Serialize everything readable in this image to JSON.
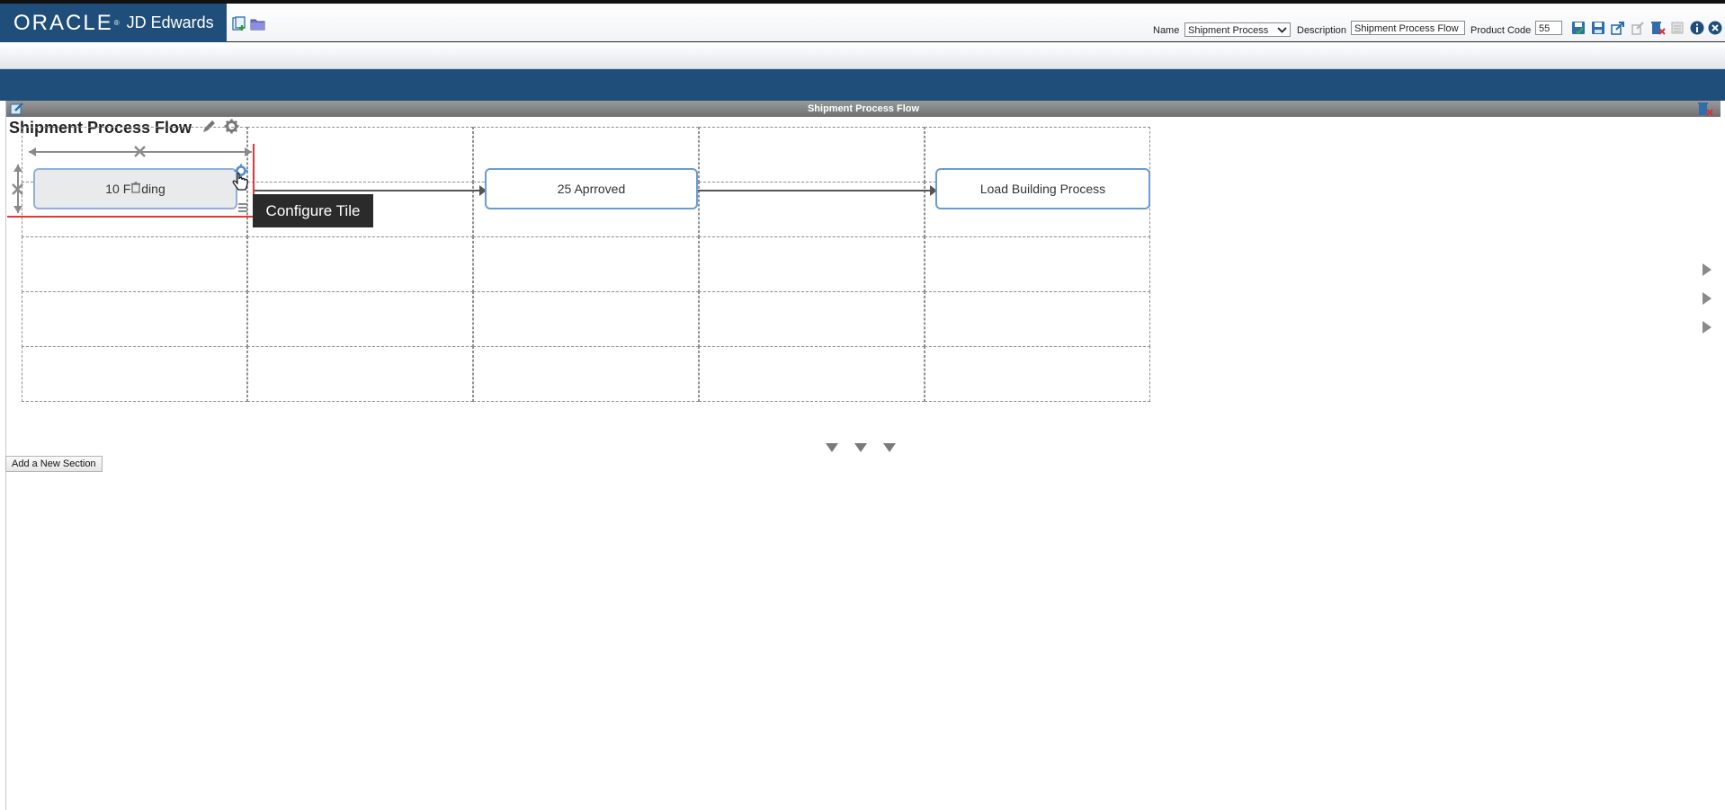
{
  "header": {
    "brand_oracle": "ORACLE",
    "brand_reg": "®",
    "brand_product": "JD Edwards",
    "name_label": "Name",
    "name_value": "Shipment Process",
    "description_label": "Description",
    "description_value": "Shipment Process Flow",
    "product_code_label": "Product Code",
    "product_code_value": "55"
  },
  "panel": {
    "title": "Shipment Process Flow"
  },
  "flow": {
    "title": "Shipment Process Flow",
    "tiles": [
      {
        "label": "10 Pending",
        "display_label": "10 F",
        "display_label_tail": "ding",
        "selected": true
      },
      {
        "label": "25 Aprroved"
      },
      {
        "label": "Load Building Process"
      }
    ]
  },
  "tooltip": {
    "text": "Configure Tile"
  },
  "actions": {
    "add_section_label": "Add a New Section"
  },
  "colors": {
    "brand_blue": "#1e4e79",
    "tile_border": "#6b9ccc",
    "selection_red": "#e0383b"
  },
  "icons": {
    "new_layout": "new-layout-icon",
    "open_folder": "folder-icon",
    "save": "save-icon",
    "save_as": "save-as-icon",
    "share": "share-icon",
    "request_publish": "request-publish-icon",
    "reserve": "reserve-icon",
    "delete": "delete-icon",
    "info": "info-icon",
    "close": "close-icon"
  }
}
